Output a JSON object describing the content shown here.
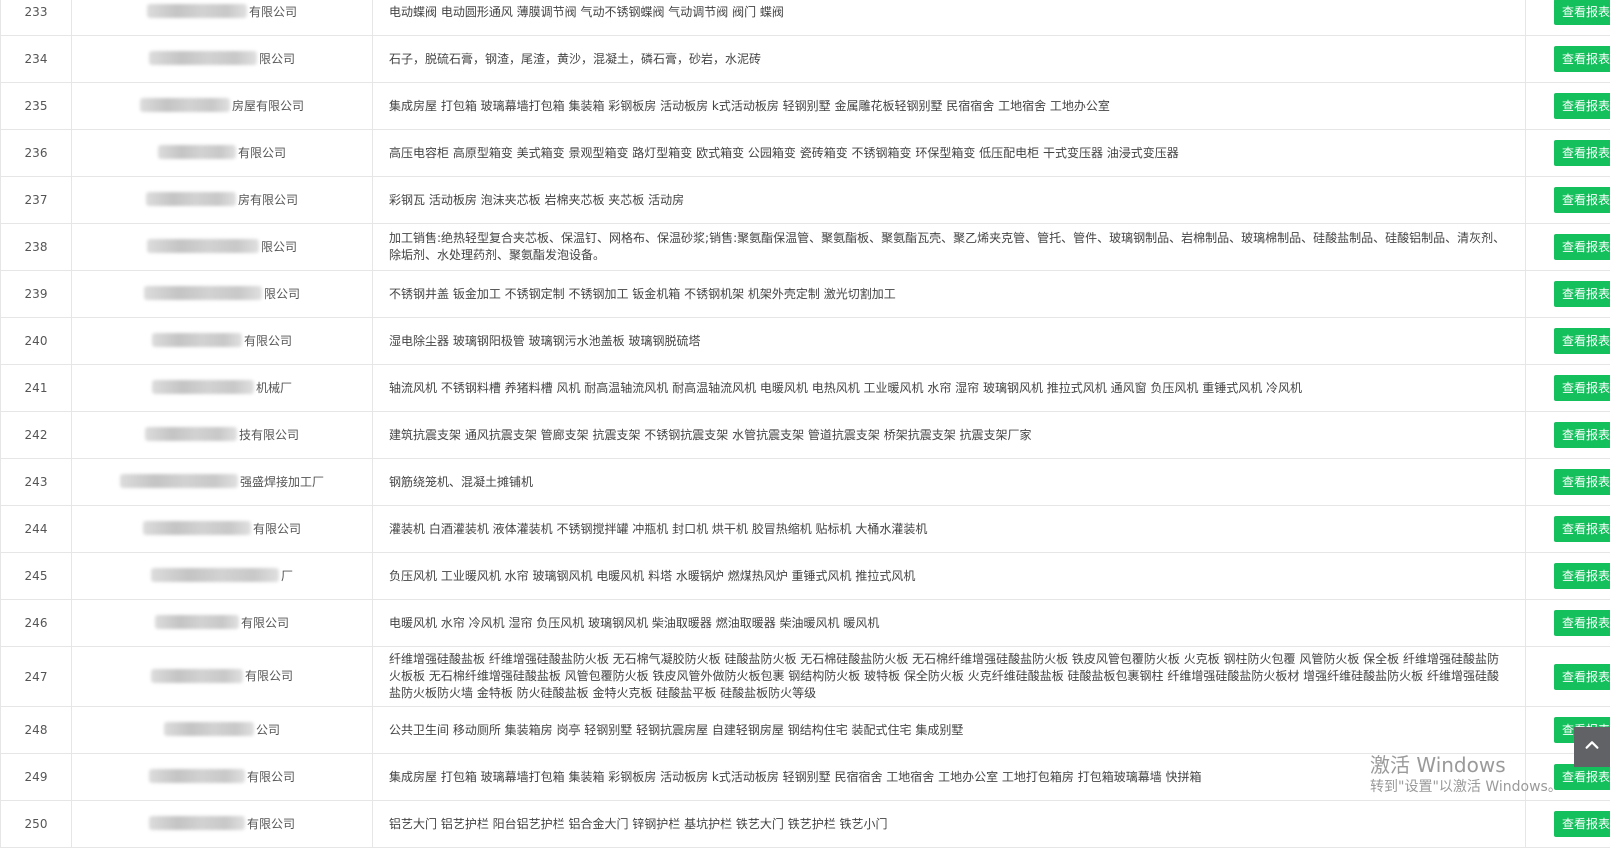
{
  "table": {
    "action_label": "查看报表",
    "rows": [
      {
        "no": "233",
        "company_suffix": "有限公司",
        "mask_width": 100,
        "products": "电动蝶阀 电动圆形通风 薄膜调节阀 气动不锈钢蝶阀 气动调节阀 阀门 蝶阀"
      },
      {
        "no": "234",
        "company_suffix": "限公司",
        "mask_width": 108,
        "products": "石子，脱硫石膏，钢渣，尾渣，黄沙，混凝土，磷石膏，砂岩，水泥砖"
      },
      {
        "no": "235",
        "company_suffix": "房屋有限公司",
        "mask_width": 90,
        "products": "集成房屋 打包箱 玻璃幕墙打包箱 集装箱 彩钢板房 活动板房 k式活动板房 轻钢别墅 金属雕花板轻钢别墅 民宿宿舍 工地宿舍 工地办公室"
      },
      {
        "no": "236",
        "company_suffix": "有限公司",
        "mask_width": 78,
        "products": "高压电容柜 高原型箱变 美式箱变 景观型箱变 路灯型箱变 欧式箱变 公园箱变 瓷砖箱变 不锈钢箱变 环保型箱变 低压配电柜 干式变压器 油浸式变压器"
      },
      {
        "no": "237",
        "company_suffix": "房有限公司",
        "mask_width": 90,
        "products": "彩钢瓦 活动板房 泡沫夹芯板 岩棉夹芯板 夹芯板 活动房"
      },
      {
        "no": "238",
        "company_suffix": "限公司",
        "mask_width": 112,
        "products": "加工销售:绝热轻型复合夹芯板、保温钉、网格布、保温砂浆;销售:聚氨酯保温管、聚氨酯板、聚氨酯瓦壳、聚乙烯夹克管、管托、管件、玻璃钢制品、岩棉制品、玻璃棉制品、硅酸盐制品、硅酸铝制品、清灰剂、除垢剂、水处理药剂、聚氨酯发泡设备。"
      },
      {
        "no": "239",
        "company_suffix": "限公司",
        "mask_width": 118,
        "products": "不锈钢井盖 钣金加工 不锈钢定制 不锈钢加工 钣金机箱 不锈钢机架 机架外壳定制 激光切割加工"
      },
      {
        "no": "240",
        "company_suffix": "有限公司",
        "mask_width": 90,
        "products": "湿电除尘器 玻璃钢阳极管 玻璃钢污水池盖板 玻璃钢脱硫塔"
      },
      {
        "no": "241",
        "company_suffix": "机械厂",
        "mask_width": 102,
        "products": "轴流风机 不锈钢料槽 养猪料槽 风机 耐高温轴流风机 耐高温轴流风机 电暖风机 电热风机 工业暖风机 水帘 湿帘 玻璃钢风机 推拉式风机 通风窗 负压风机 重锤式风机 冷风机"
      },
      {
        "no": "242",
        "company_suffix": "技有限公司",
        "mask_width": 92,
        "products": "建筑抗震支架 通风抗震支架 管廊支架 抗震支架 不锈钢抗震支架 水管抗震支架 管道抗震支架 桥架抗震支架 抗震支架厂家"
      },
      {
        "no": "243",
        "company_suffix": "强盛焊接加工厂",
        "mask_width": 118,
        "products": "钢筋绕笼机、混凝土摊铺机"
      },
      {
        "no": "244",
        "company_suffix": "有限公司",
        "mask_width": 108,
        "products": "灌装机 白酒灌装机 液体灌装机 不锈钢搅拌罐 冲瓶机 封口机 烘干机 胶冒热缩机 贴标机 大桶水灌装机"
      },
      {
        "no": "245",
        "company_suffix": "厂",
        "mask_width": 128,
        "products": "负压风机 工业暖风机 水帘 玻璃钢风机 电暖风机 料塔 水暖锅炉 燃煤热风炉 重锤式风机 推拉式风机"
      },
      {
        "no": "246",
        "company_suffix": "有限公司",
        "mask_width": 84,
        "products": "电暖风机 水帘 冷风机 湿帘 负压风机 玻璃钢风机 柴油取暖器 燃油取暖器 柴油暖风机 暖风机"
      },
      {
        "no": "247",
        "company_suffix": "有限公司",
        "mask_width": 92,
        "products": "纤维增强硅酸盐板 纤维增强硅酸盐防火板 无石棉气凝胶防火板 硅酸盐防火板 无石棉硅酸盐防火板 无石棉纤维增强硅酸盐防火板 铁皮风管包覆防火板 火克板 钢柱防火包覆 风管防火板 保全板 纤维增强硅酸盐防火板板 无石棉纤维增强硅酸盐板 风管包覆防火板 铁皮风管外做防火板包裹 钢结构防火板 玻特板 保全防火板 火克纤维硅酸盐板 硅酸盐板包裹钢柱 纤维增强硅酸盐防火板材 增强纤维硅酸盐防火板 纤维增强硅酸盐防火板防火墙 金特板 防火硅酸盐板 金特火克板 硅酸盐平板 硅酸盐板防火等级"
      },
      {
        "no": "248",
        "company_suffix": "公司",
        "mask_width": 90,
        "products": "公共卫生间 移动厕所 集装箱房 岗亭 轻钢别墅 轻钢抗震房屋 自建轻钢房屋 钢结构住宅 装配式住宅 集成别墅"
      },
      {
        "no": "249",
        "company_suffix": "有限公司",
        "mask_width": 96,
        "products": "集成房屋 打包箱 玻璃幕墙打包箱 集装箱 彩钢板房 活动板房 k式活动板房 轻钢别墅 民宿宿舍 工地宿舍 工地办公室 工地打包箱房 打包箱玻璃幕墙 快拼箱"
      },
      {
        "no": "250",
        "company_suffix": "有限公司",
        "mask_width": 96,
        "products": "铝艺大门 铝艺护栏 阳台铝艺护栏 铝合金大门 锌钢护栏 基坑护栏 铁艺大门 铁艺护栏 铁艺小门"
      }
    ]
  },
  "back_to_top": {
    "icon": "chevron-up-icon"
  },
  "watermark": {
    "title": "激活 Windows",
    "subtitle": "转到\"设置\"以激活 Windows。"
  },
  "colors": {
    "accent": "#13c05c",
    "border": "#e6e6e6",
    "back_to_top_bg": "#606266"
  }
}
